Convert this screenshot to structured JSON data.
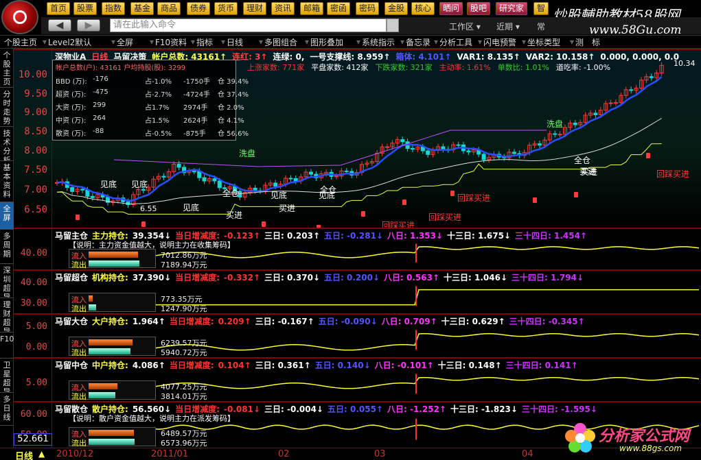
{
  "menu": {
    "items": [
      "首页",
      "股票",
      "指数",
      "基金",
      "商品",
      "债券",
      "货币",
      "理财",
      "资讯",
      "邮箱",
      "密函",
      "密码",
      "金股",
      "核心",
      "晒问",
      "股吧",
      "研究家",
      "智"
    ],
    "watermark": "炒股輔助教材58股网",
    "watermark_url": "www.58Gu.com"
  },
  "cmdbar": {
    "back": "◀",
    "forward": "▶",
    "input_placeholder": "请在此输入命令",
    "workspace": "工作区",
    "recent": "近期",
    "often": "常"
  },
  "toolbar": {
    "items": [
      "个股主页",
      "Level2默认",
      "全屏",
      "F10资料",
      "指标",
      "日线",
      "多图组合",
      "图形叠加",
      "系统指示",
      "备忘录",
      "分析工具",
      "闪电预警",
      "坐标类型",
      "测",
      "标"
    ]
  },
  "sidetabs": [
    "个股主页",
    "分时走势",
    "技术分析",
    "基本资料",
    "全屏",
    "多周期",
    "深圳超导",
    "理财超导",
    "F10",
    "卫星超导",
    "多日线"
  ],
  "main": {
    "title_parts": [
      {
        "text": "深物业A",
        "color": "#fff"
      },
      {
        "text": "日线",
        "color": "#f44"
      },
      {
        "text": "马留决策",
        "color": "#fff"
      },
      {
        "text": "帐户总数: 43161↑",
        "color": "#ff4"
      },
      {
        "text": "连红: 3↑",
        "color": "#f44"
      },
      {
        "text": "连绿: 0,",
        "color": "#fff"
      },
      {
        "text": "一号支撑线: 8.959↑",
        "color": "#fff"
      },
      {
        "text": "箱体: 4.101↑",
        "color": "#55f"
      },
      {
        "text": "VAR1: 8.135↑",
        "color": "#fff"
      },
      {
        "text": "VAR2: 10.158↑",
        "color": "#fff"
      },
      {
        "text": "0.000, 0.000, 0.0",
        "color": "#fff"
      }
    ],
    "stats_line": [
      {
        "text": "上涨家数: 771家",
        "color": "#f33"
      },
      {
        "text": "平盘家数: 412家",
        "color": "#fff"
      },
      {
        "text": "下跌家数: 321家",
        "color": "#3c3"
      },
      {
        "text": "主动率: 1.61%",
        "color": "#f33"
      },
      {
        "text": "单数比: 1.01%",
        "color": "#3c3"
      },
      {
        "text": "道吃率: -1.00%",
        "color": "#fff"
      }
    ],
    "price_labels": [
      "10.00",
      "9.50",
      "9.00",
      "8.50",
      "8.00",
      "7.50",
      "7.00",
      "6.50"
    ],
    "last_price": "10.34",
    "low_price": "6.55",
    "annotations": [
      "见底",
      "见底",
      "见底",
      "全仓",
      "见底",
      "见底",
      "买进",
      "买进",
      "全仓",
      "回踩买进",
      "回踩买进",
      "回踩买进",
      "全仓",
      "买进",
      "洗盘",
      "洗盘",
      "买进",
      "回踩买进"
    ]
  },
  "infobox": {
    "header": "帐户总数(户): 43161   户均持股(股): 3299",
    "rows": [
      {
        "label": "BBD (万):",
        "value": "-176",
        "pct": "占-1.0%",
        "hands": "-1750手",
        "cang": "仓 39.4%"
      },
      {
        "label": "超资 (万):",
        "value": "-475",
        "pct": "占-2.7%",
        "hands": "-4724手",
        "cang": "仓 37.4%"
      },
      {
        "label": "大资 (万):",
        "value": "299",
        "pct": "占1.7%",
        "hands": "2974手",
        "cang": "仓 2.0%"
      },
      {
        "label": "中资 (万):",
        "value": "264",
        "pct": "占1.5%",
        "hands": "2624手",
        "cang": "仓 4.1%"
      },
      {
        "label": "散资 (万):",
        "value": "-88",
        "pct": "占-0.5%",
        "hands": "-875手",
        "cang": "仓 56.6%"
      }
    ]
  },
  "indicators": [
    {
      "name": "马留主仓",
      "pos_label": "主力持仓:",
      "pos": "39.354↓",
      "d1_label": "当日增减度:",
      "d1": "-0.123↑",
      "d3": "三日: 0.203↑",
      "d5": "五日: -0.281↓",
      "d8": "八日: 1.353↓",
      "d13": "十三日: 1.675↓",
      "d34": "三十四日: 1.454↑",
      "note": "【说明：主力资金值越大，说明主力在收集筹码】",
      "in_label": "流入",
      "out_label": "流出",
      "in_amt": "7012.86万元",
      "out_amt": "7189.94万元",
      "y_labels": [
        "40.00"
      ],
      "in_w": 72,
      "out_w": 74
    },
    {
      "name": "马留超仓",
      "pos_label": "机构持仓:",
      "pos": "37.390↓",
      "d1_label": "当日增减度:",
      "d1": "-0.332↑",
      "d3": "三日: 0.370↓",
      "d5": "五日: 0.200↓",
      "d8": "八日: 0.563↑",
      "d13": "十三日: 1.046↓",
      "d34": "三十四日: 1.794↓",
      "note": "",
      "in_label": "流入",
      "out_label": "流出",
      "in_amt": "773.35万元",
      "out_amt": "1247.90万元",
      "y_labels": [
        "40.00",
        "30.00"
      ],
      "in_w": 6,
      "out_w": 11
    },
    {
      "name": "马留大仓",
      "pos_label": "大户持仓:",
      "pos": "1.964↑",
      "d1_label": "当日增减度:",
      "d1": "0.209↑",
      "d3": "三日: -0.167↑",
      "d5": "五日: -0.090↓",
      "d8": "八日: 0.709↑",
      "d13": "十三日: 0.629↑",
      "d34": "三十四日: -0.345↑",
      "note": "",
      "in_label": "流入",
      "out_label": "流出",
      "in_amt": "6239.57万元",
      "out_amt": "5940.72万元",
      "y_labels": [
        "5.00",
        "0.00"
      ],
      "in_w": 64,
      "out_w": 61
    },
    {
      "name": "马留中仓",
      "pos_label": "中户持仓:",
      "pos": "4.086↑",
      "d1_label": "当日增减度:",
      "d1": "0.104↑",
      "d3": "三日: 0.361↑",
      "d5": "五日: 0.140↓",
      "d8": "八日: -0.101↑",
      "d13": "十三日: 0.148↑",
      "d34": "三十四日: 0.141↑",
      "note": "",
      "in_label": "流入",
      "out_label": "流出",
      "in_amt": "4077.25万元",
      "out_amt": "3814.01万元",
      "y_labels": [
        "5.00"
      ],
      "in_w": 42,
      "out_w": 39
    },
    {
      "name": "马留散仓",
      "pos_label": "散户持仓:",
      "pos": "56.560↓",
      "d1_label": "当日增减度:",
      "d1": "-0.081↓",
      "d3": "三日: -0.004↓",
      "d5": "五日: 0.055↑",
      "d8": "八日: -1.252↑",
      "d13": "十三日: -1.823↓",
      "d34": "三十四日: -1.595↓",
      "note": "【说明：散户资金值越大，说明主力在派发筹码】",
      "in_label": "流入",
      "out_label": "流出",
      "in_amt": "6489.57万元",
      "out_amt": "6573.96万元",
      "y_labels": [
        "60.00",
        "50.00"
      ],
      "in_w": 66,
      "out_w": 67
    }
  ],
  "bottom": {
    "period": "日线",
    "value": "52.661",
    "dates": [
      "2010/12",
      "2011/01",
      "02",
      "03",
      "04"
    ]
  },
  "brand": {
    "text": "分析家公式网",
    "url": "www.88gs.com"
  }
}
